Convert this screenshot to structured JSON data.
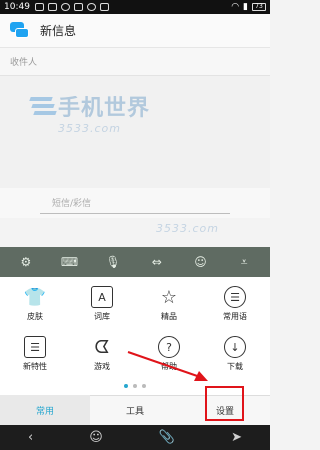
{
  "status_bar": {
    "time": "10:49",
    "battery": "73"
  },
  "app": {
    "title": "新信息"
  },
  "recipient": {
    "placeholder": "收件人"
  },
  "compose": {
    "placeholder": "短信/彩信"
  },
  "watermark": {
    "name": "手机世界",
    "url": "3533.com"
  },
  "keyboard": {
    "toolbar_icons": [
      "gear-icon",
      "keyboard-icon",
      "microphone-icon",
      "cursor-icon",
      "emoji-icon",
      "collapse-icon"
    ],
    "grid": [
      {
        "label": "皮肤",
        "icon": "tshirt-icon",
        "glyph": "👕"
      },
      {
        "label": "词库",
        "icon": "dictionary-icon",
        "glyph": "A"
      },
      {
        "label": "精品",
        "icon": "star-icon",
        "glyph": "☆"
      },
      {
        "label": "常用语",
        "icon": "phrases-icon",
        "glyph": "☰"
      },
      {
        "label": "新特性",
        "icon": "new-features-icon",
        "glyph": "☰"
      },
      {
        "label": "游戏",
        "icon": "game-icon",
        "glyph": "ᗧ"
      },
      {
        "label": "帮助",
        "icon": "help-icon",
        "glyph": "?"
      },
      {
        "label": "下载",
        "icon": "download-icon",
        "glyph": "↓"
      }
    ],
    "tabs": [
      {
        "label": "常用"
      },
      {
        "label": "工具"
      },
      {
        "label": "设置"
      }
    ],
    "accent_color": "#27a7cf",
    "highlight_color": "#e0141a"
  },
  "navigation": {
    "back": "‹",
    "emoji": "☺",
    "attach": "📎",
    "send": "➤"
  }
}
